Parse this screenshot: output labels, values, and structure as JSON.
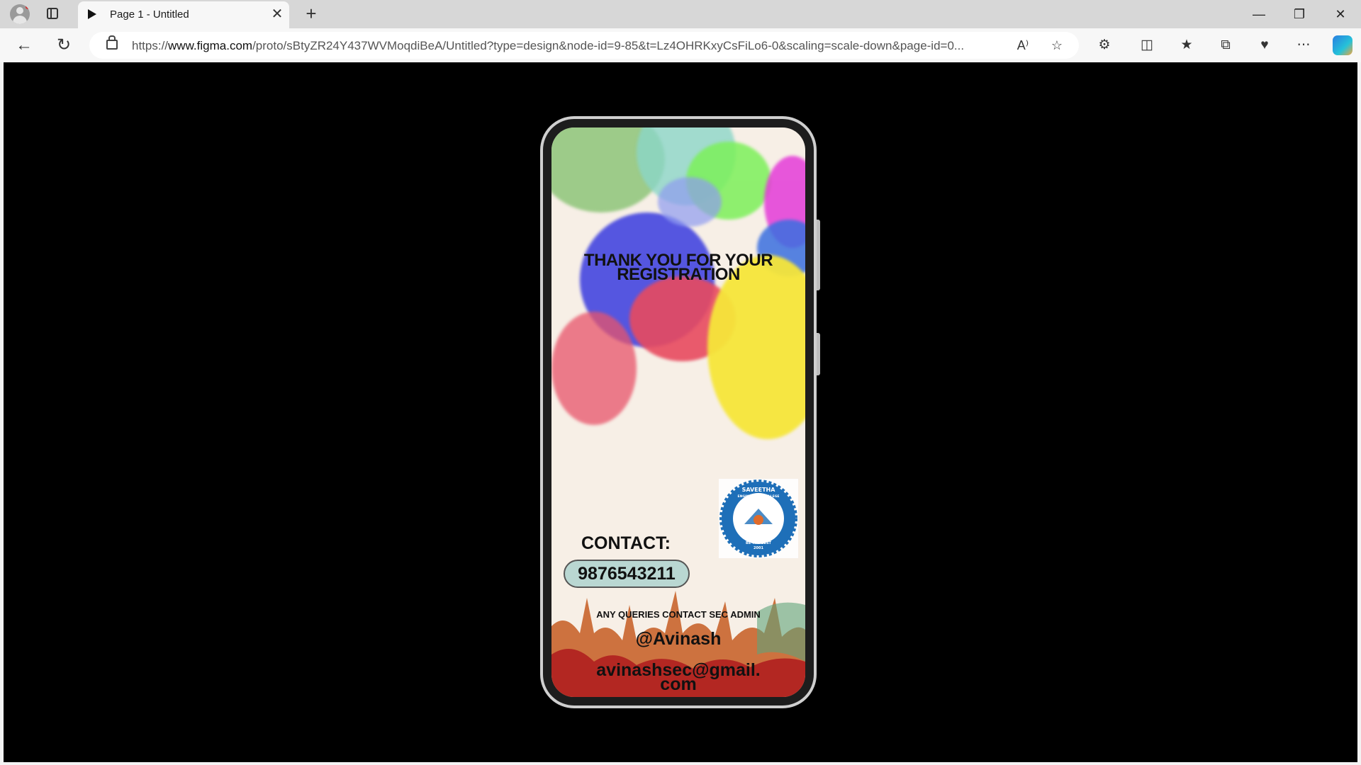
{
  "browser": {
    "tab_title": "Page 1 - Untitled",
    "tab_close": "✕",
    "new_tab": "+",
    "url_prefix": "https://",
    "url_domain": "www.figma.com",
    "url_path": "/proto/sBtyZR24Y437WVMoqdiBeA/Untitled?type=design&node-id=9-85&t=Lz4OHRKxyCsFiLo6-0&scaling=scale-down&page-id=0...",
    "read_aloud": "A⁾",
    "window_controls": {
      "minimize": "—",
      "restore": "❐",
      "close": "✕"
    },
    "icons": [
      "back-icon",
      "refresh-icon",
      "lock-icon",
      "read-aloud-icon",
      "favorite-star-icon",
      "extensions-icon",
      "split-screen-icon",
      "favorites-icon",
      "collections-icon",
      "browser-essentials-icon",
      "more-icon",
      "copilot-icon"
    ]
  },
  "prototype": {
    "heading_line1": "THANK YOU FOR YOUR",
    "heading_line2": "REGISTRATION",
    "contact_label": "CONTACT:",
    "phone_number": "9876543211",
    "queries": "ANY QUERIES CONTACT SEC ADMIN",
    "handle": "@Avinash",
    "email_line1": "avinashsec@gmail.",
    "email_line2": "com",
    "logo": {
      "name": "SAVEETHA",
      "subtitle": "ENGINEERING COLLEGE",
      "motto": "BE THE BEST",
      "year": "2001"
    }
  },
  "colors": {
    "tabstrip": "#d7d7d7",
    "toolbar": "#f7f7f7",
    "viewport": "#000000",
    "pill": "#b9d7d2",
    "logo_blue": "#1e6fb8"
  }
}
